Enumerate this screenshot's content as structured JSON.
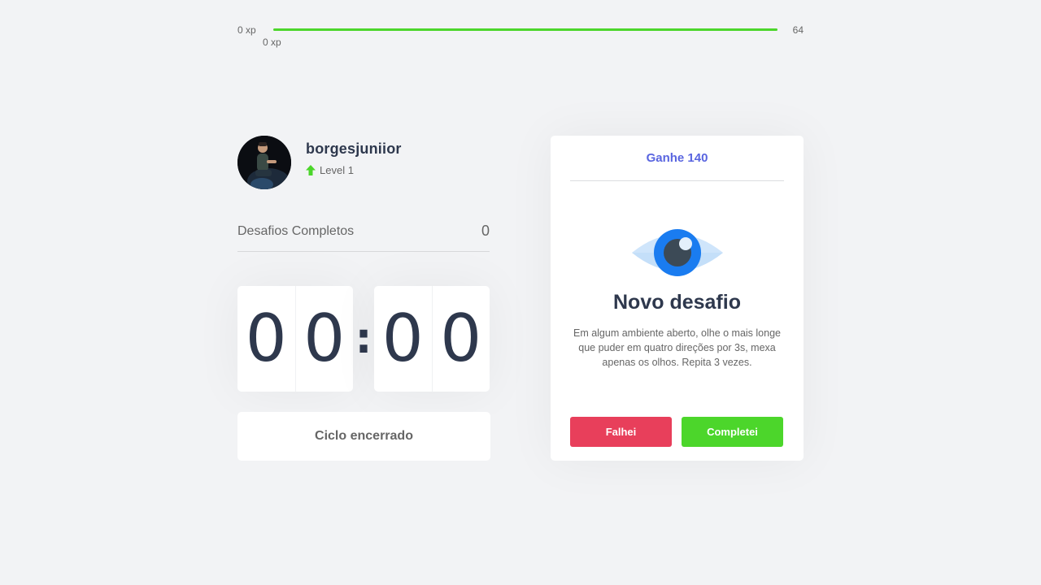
{
  "xp_bar": {
    "min_label": "0 xp",
    "current_label": "0 xp",
    "max_label": "64",
    "progress": 1.0,
    "fill_color": "#4cd62b"
  },
  "profile": {
    "username": "borgesjuniior",
    "level_label": "Level 1",
    "level_icon": "level-up-arrow-icon"
  },
  "completed_challenges": {
    "label": "Desafios Completos",
    "count": "0"
  },
  "countdown": {
    "minute_left": "0",
    "minute_right": "0",
    "separator": ":",
    "second_left": "0",
    "second_right": "0"
  },
  "cycle_button": {
    "label": "Ciclo encerrado"
  },
  "challenge": {
    "header": "Ganhe 140",
    "icon": "eye-icon",
    "title": "Novo desafio",
    "description": "Em algum ambiente aberto, olhe o mais longe que puder em quatro direções por 3s, mexa apenas os olhos. Repita 3 vezes.",
    "fail_label": "Falhei",
    "complete_label": "Completei"
  },
  "colors": {
    "background": "#f2f3f5",
    "accent_blue": "#5965e0",
    "success_green": "#4cd62b",
    "danger_red": "#e83f5b",
    "title_text": "#2e384d",
    "body_text": "#666666"
  }
}
